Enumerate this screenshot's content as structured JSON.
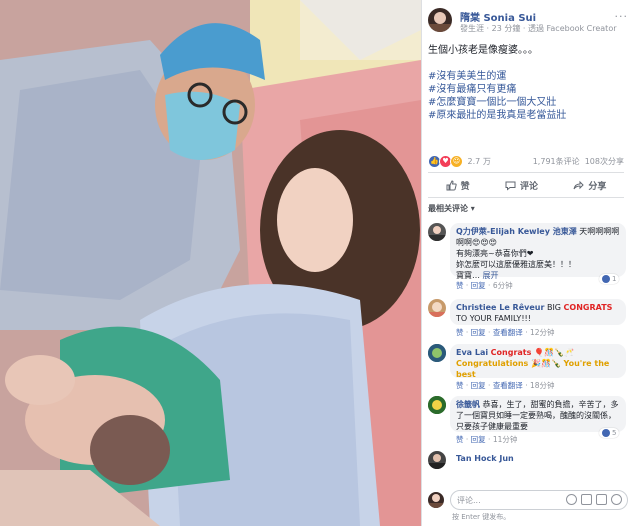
{
  "post": {
    "author": "隋棠 Sonia Sui",
    "meta": "發生涯 · 23 分鐘 · 透過 Facebook Creator",
    "more": "···",
    "text_line1": "生個小孩老是像瘦婆。。。",
    "hashtags": [
      "#沒有美美生的運",
      "#沒有最痛只有更痛",
      "#怎麼寶寶一個比一個大又壯",
      "#原來最壯的是我真是老當益壯"
    ]
  },
  "reactions": {
    "count": "2.7 万",
    "comments": "1,791条评论",
    "shares": "108次分享"
  },
  "actions": {
    "like": "赞",
    "comment": "评论",
    "share": "分享"
  },
  "sort_label": "最相关评论 ▾",
  "comments": [
    {
      "name": "Q力伊萊-Elijah Kewley 池東澤",
      "text1": "天啊啊啊啊啊啊😍😍😍",
      "text2": "有夠漂亮~恭喜你們❤",
      "text3": "妳怎麼可以這麼優雅這麼美！！！",
      "text4": "寶寶…",
      "more": "展开",
      "like": "赞",
      "reply": "回复",
      "time": "6分钟",
      "likes": "1"
    },
    {
      "name": "Christiee Le Rêveur",
      "text_prefix": "BIG ",
      "text_hl": "CONGRATS",
      "text_suffix": "TO YOUR FAMILY!!!",
      "like": "赞",
      "reply": "回复",
      "translate": "查看翻译",
      "time": "12分钟"
    },
    {
      "name": "Eva Lai",
      "text_a": "Congrats 🎈🎊🍾🥂",
      "text_b": "Congratulations 🎉🎊🍾",
      "text_c": "You're the best",
      "like": "赞",
      "reply": "回复",
      "translate": "查看翻译",
      "time": "18分钟"
    },
    {
      "name": "徐籤帆",
      "text": "恭喜，生了，甜蜜的負擔，辛苦了，多了一個寶貝如睡一定要熟喝，醜醜的沒關係，只要孩子健康最重要",
      "like": "赞",
      "reply": "回复",
      "time": "11分钟",
      "likes": "5"
    },
    {
      "name": "Tan Hock Jun"
    }
  ],
  "input": {
    "placeholder": "评论...",
    "hint": "按 Enter 键发布。"
  },
  "colors": {
    "link": "#385898",
    "accent": "#4267b2",
    "bubble": "#f2f3f5"
  }
}
